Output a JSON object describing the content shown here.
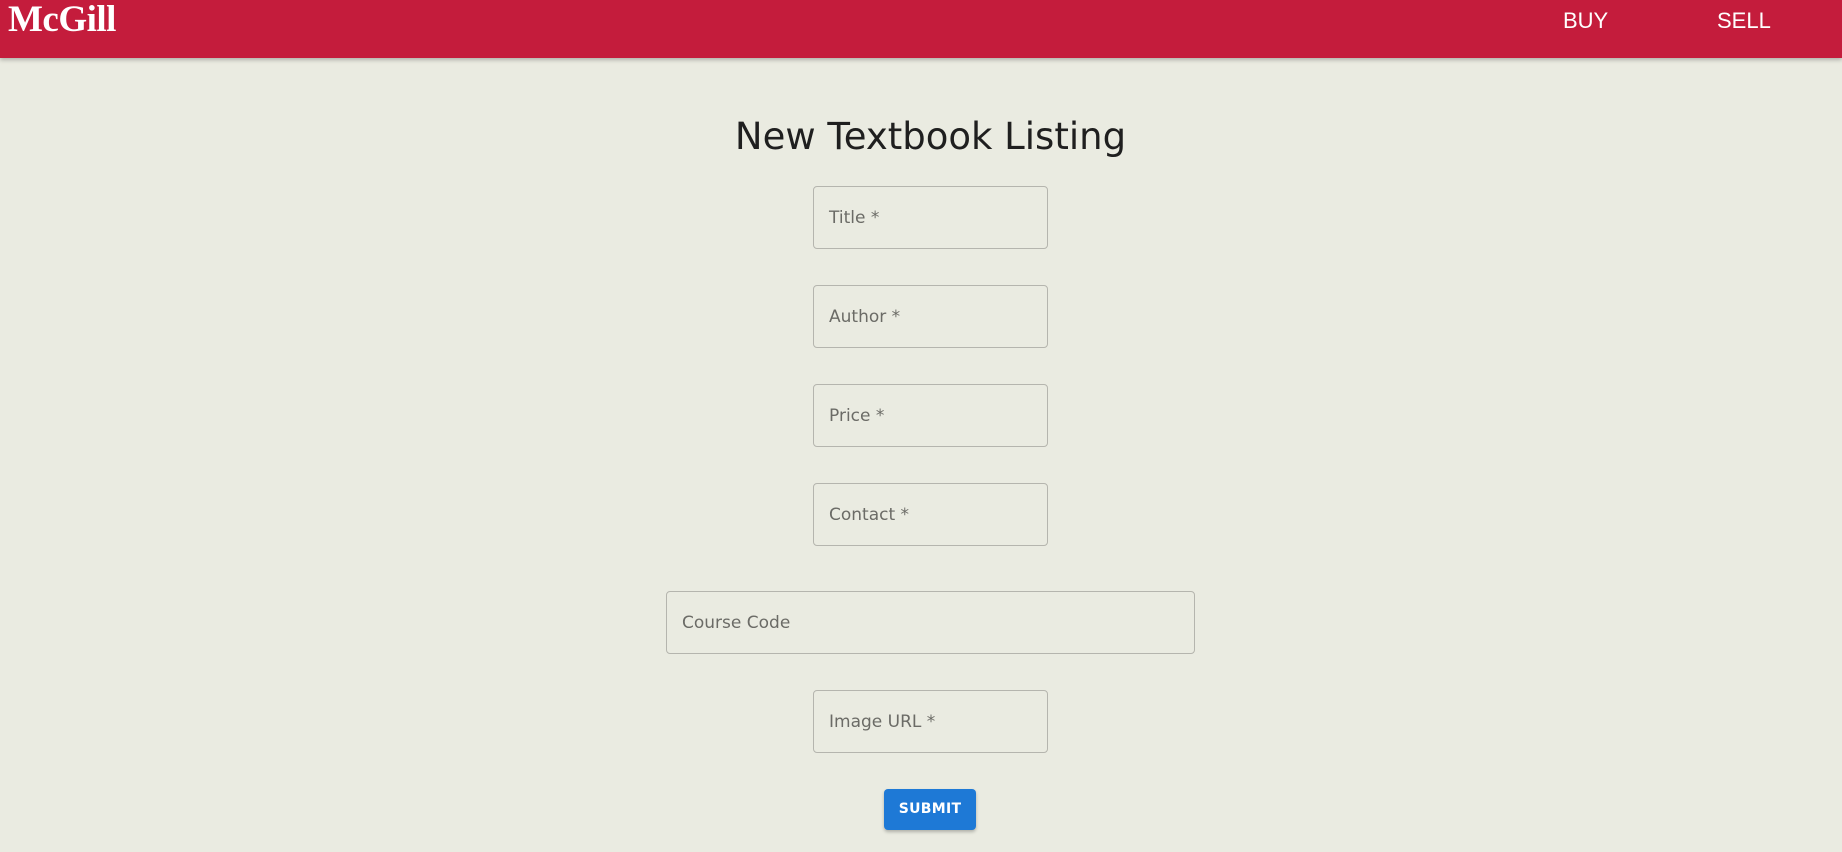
{
  "header": {
    "logo_text": "McGill",
    "nav": {
      "buy_label": "BUY",
      "sell_label": "SELL"
    },
    "background_color": "#c41c3c"
  },
  "main": {
    "title": "New Textbook Listing",
    "fields": {
      "title_placeholder": "Title *",
      "author_placeholder": "Author *",
      "price_placeholder": "Price *",
      "contact_placeholder": "Contact *",
      "course_code_placeholder": "Course Code",
      "image_url_placeholder": "Image URL *"
    },
    "submit_label": "SUBMIT",
    "submit_color": "#1e79d6"
  }
}
